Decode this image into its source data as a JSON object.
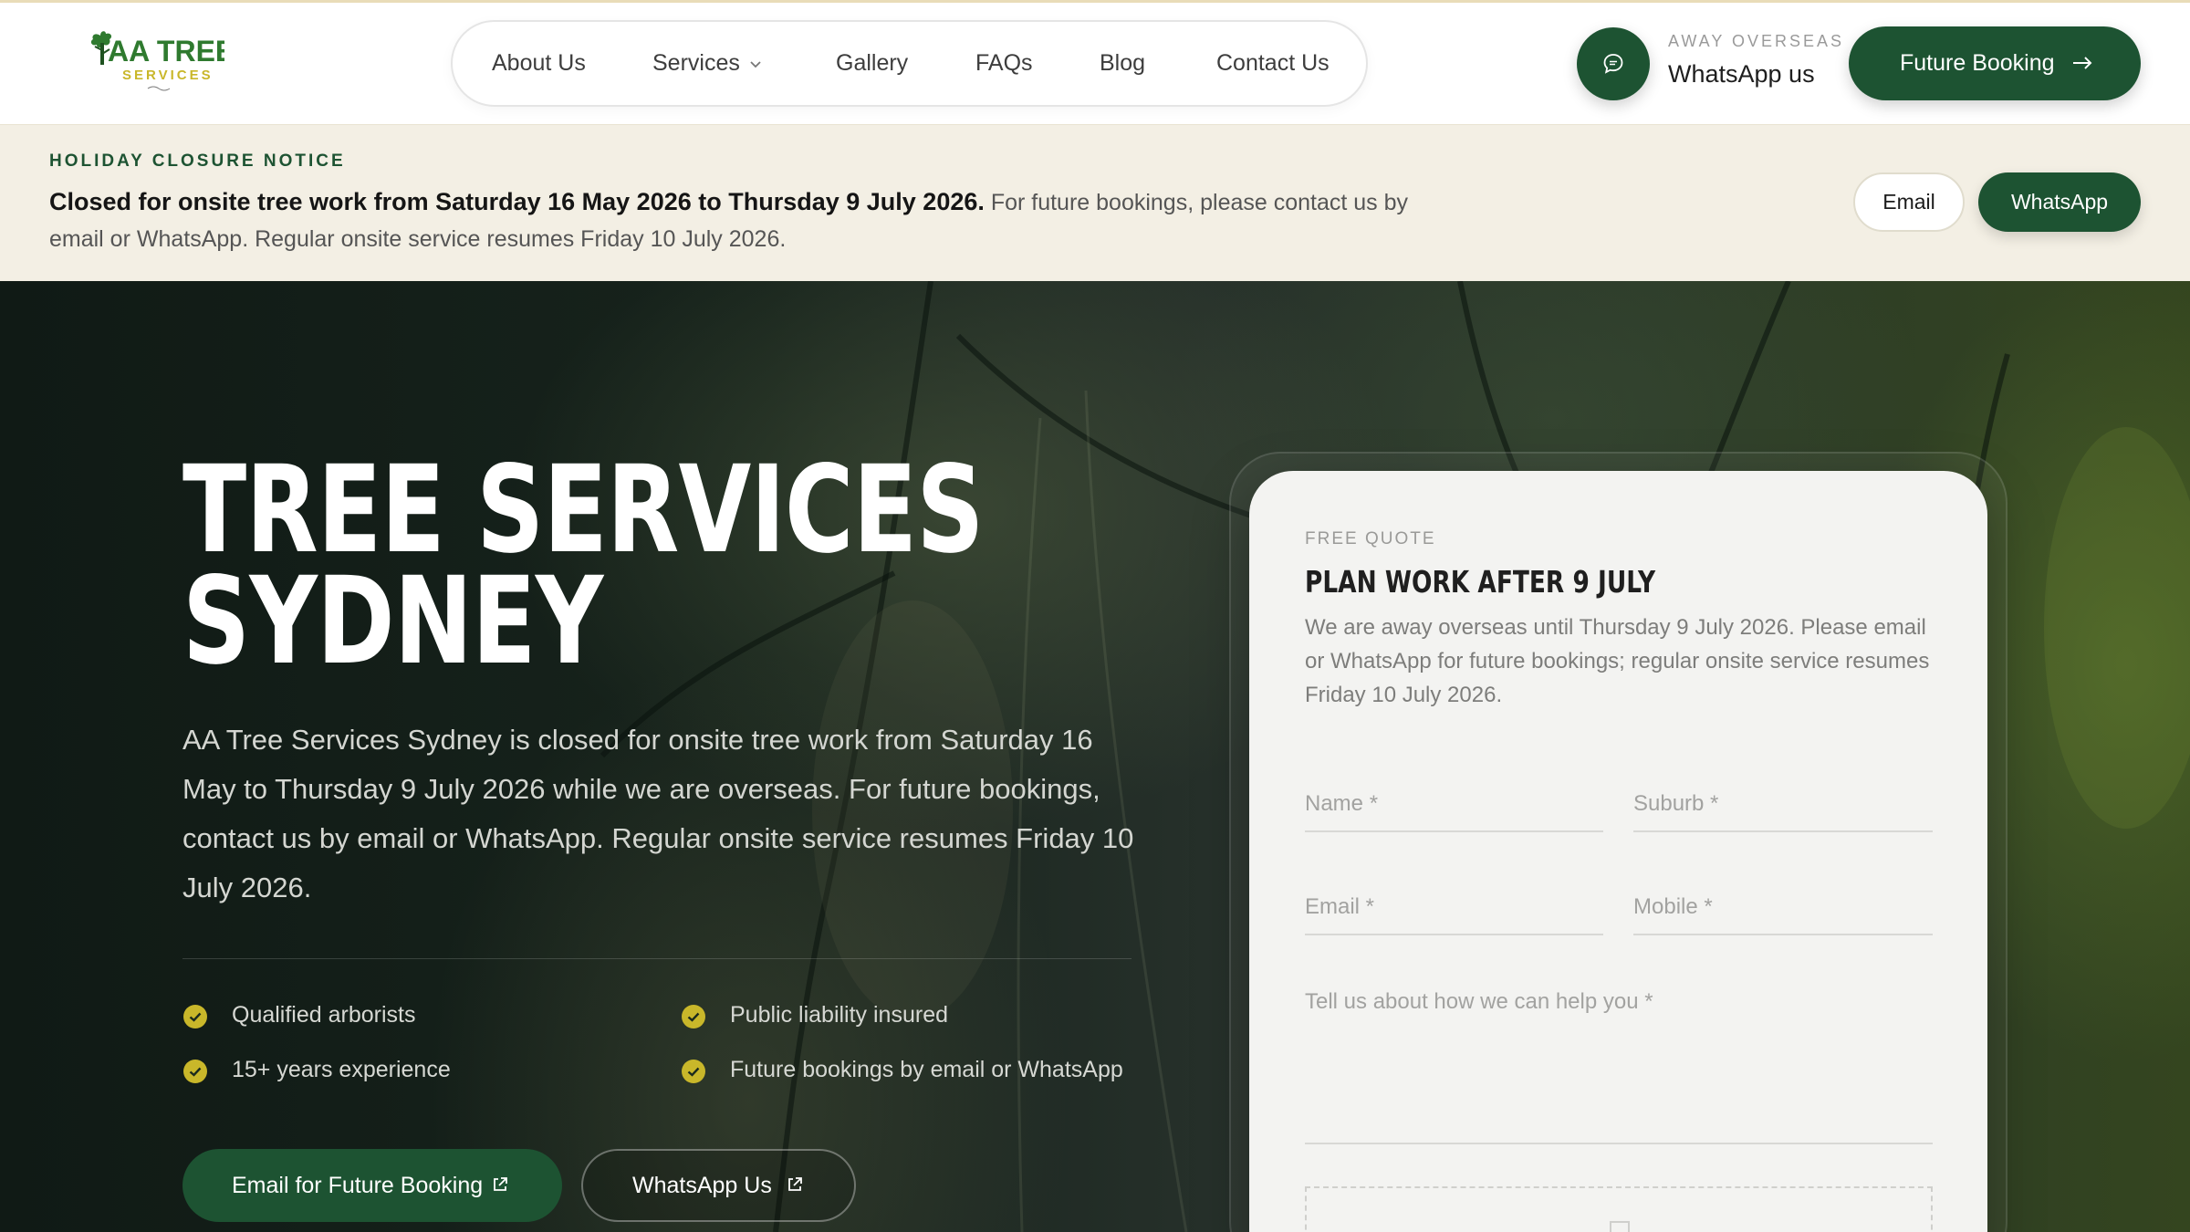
{
  "header": {
    "logo_text": "AA TREE",
    "logo_sub": "SERVICES",
    "nav": [
      {
        "label": "About Us"
      },
      {
        "label": "Services"
      },
      {
        "label": "Gallery"
      },
      {
        "label": "FAQs"
      },
      {
        "label": "Blog"
      },
      {
        "label": "Contact Us"
      }
    ],
    "away_label": "AWAY OVERSEAS",
    "away_link": "WhatsApp us",
    "cta": "Future Booking"
  },
  "notice": {
    "eyebrow": "HOLIDAY CLOSURE NOTICE",
    "bold": "Closed for onsite tree work from Saturday 16 May 2026 to Thursday 9 July 2026.",
    "text": " For future bookings, please contact us by email or WhatsApp. Regular onsite service resumes Friday 10 July 2026.",
    "email_btn": "Email",
    "whatsapp_btn": "WhatsApp"
  },
  "hero": {
    "title_line1": "TREE SERVICES",
    "title_line2": "SYDNEY",
    "body": "AA Tree Services Sydney is closed for onsite tree work from Saturday 16 May to Thursday 9 July 2026 while we are overseas. For future bookings, contact us by email or WhatsApp. Regular onsite service resumes Friday 10 July 2026.",
    "features": [
      "Qualified arborists",
      "Public liability insured",
      "15+ years experience",
      "Future bookings by email or WhatsApp"
    ],
    "btn_email": "Email for Future Booking",
    "btn_whatsapp": "WhatsApp Us"
  },
  "form": {
    "eyebrow": "FREE QUOTE",
    "title": "PLAN WORK AFTER 9 JULY",
    "desc": "We are away overseas until Thursday 9 July 2026. Please email or WhatsApp for future bookings; regular onsite service resumes Friday 10 July 2026.",
    "placeholders": {
      "name": "Name *",
      "suburb": "Suburb *",
      "email": "Email *",
      "mobile": "Mobile *",
      "message": "Tell us about how we can help you *"
    }
  },
  "colors": {
    "brand_green": "#1d5332",
    "check_yellow": "#c9b72a",
    "notice_bg": "#f3efe4"
  },
  "icons": [
    "chat-bubble-icon",
    "arrow-right-icon",
    "chevron-down-icon",
    "check-circle-icon",
    "external-link-icon"
  ]
}
